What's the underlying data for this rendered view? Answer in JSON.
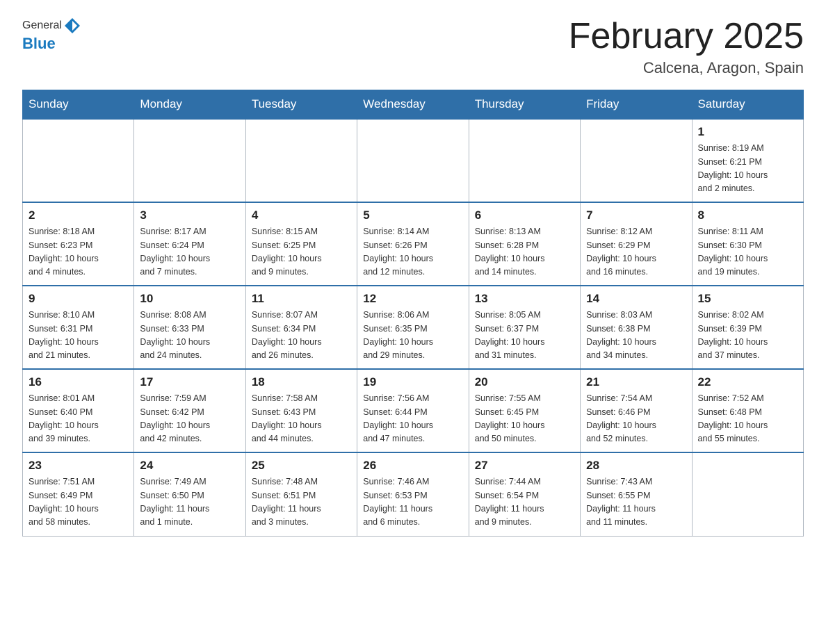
{
  "header": {
    "logo_general": "General",
    "logo_blue": "Blue",
    "month_title": "February 2025",
    "location": "Calcena, Aragon, Spain"
  },
  "weekdays": [
    "Sunday",
    "Monday",
    "Tuesday",
    "Wednesday",
    "Thursday",
    "Friday",
    "Saturday"
  ],
  "weeks": [
    [
      {
        "day": "",
        "info": ""
      },
      {
        "day": "",
        "info": ""
      },
      {
        "day": "",
        "info": ""
      },
      {
        "day": "",
        "info": ""
      },
      {
        "day": "",
        "info": ""
      },
      {
        "day": "",
        "info": ""
      },
      {
        "day": "1",
        "info": "Sunrise: 8:19 AM\nSunset: 6:21 PM\nDaylight: 10 hours\nand 2 minutes."
      }
    ],
    [
      {
        "day": "2",
        "info": "Sunrise: 8:18 AM\nSunset: 6:23 PM\nDaylight: 10 hours\nand 4 minutes."
      },
      {
        "day": "3",
        "info": "Sunrise: 8:17 AM\nSunset: 6:24 PM\nDaylight: 10 hours\nand 7 minutes."
      },
      {
        "day": "4",
        "info": "Sunrise: 8:15 AM\nSunset: 6:25 PM\nDaylight: 10 hours\nand 9 minutes."
      },
      {
        "day": "5",
        "info": "Sunrise: 8:14 AM\nSunset: 6:26 PM\nDaylight: 10 hours\nand 12 minutes."
      },
      {
        "day": "6",
        "info": "Sunrise: 8:13 AM\nSunset: 6:28 PM\nDaylight: 10 hours\nand 14 minutes."
      },
      {
        "day": "7",
        "info": "Sunrise: 8:12 AM\nSunset: 6:29 PM\nDaylight: 10 hours\nand 16 minutes."
      },
      {
        "day": "8",
        "info": "Sunrise: 8:11 AM\nSunset: 6:30 PM\nDaylight: 10 hours\nand 19 minutes."
      }
    ],
    [
      {
        "day": "9",
        "info": "Sunrise: 8:10 AM\nSunset: 6:31 PM\nDaylight: 10 hours\nand 21 minutes."
      },
      {
        "day": "10",
        "info": "Sunrise: 8:08 AM\nSunset: 6:33 PM\nDaylight: 10 hours\nand 24 minutes."
      },
      {
        "day": "11",
        "info": "Sunrise: 8:07 AM\nSunset: 6:34 PM\nDaylight: 10 hours\nand 26 minutes."
      },
      {
        "day": "12",
        "info": "Sunrise: 8:06 AM\nSunset: 6:35 PM\nDaylight: 10 hours\nand 29 minutes."
      },
      {
        "day": "13",
        "info": "Sunrise: 8:05 AM\nSunset: 6:37 PM\nDaylight: 10 hours\nand 31 minutes."
      },
      {
        "day": "14",
        "info": "Sunrise: 8:03 AM\nSunset: 6:38 PM\nDaylight: 10 hours\nand 34 minutes."
      },
      {
        "day": "15",
        "info": "Sunrise: 8:02 AM\nSunset: 6:39 PM\nDaylight: 10 hours\nand 37 minutes."
      }
    ],
    [
      {
        "day": "16",
        "info": "Sunrise: 8:01 AM\nSunset: 6:40 PM\nDaylight: 10 hours\nand 39 minutes."
      },
      {
        "day": "17",
        "info": "Sunrise: 7:59 AM\nSunset: 6:42 PM\nDaylight: 10 hours\nand 42 minutes."
      },
      {
        "day": "18",
        "info": "Sunrise: 7:58 AM\nSunset: 6:43 PM\nDaylight: 10 hours\nand 44 minutes."
      },
      {
        "day": "19",
        "info": "Sunrise: 7:56 AM\nSunset: 6:44 PM\nDaylight: 10 hours\nand 47 minutes."
      },
      {
        "day": "20",
        "info": "Sunrise: 7:55 AM\nSunset: 6:45 PM\nDaylight: 10 hours\nand 50 minutes."
      },
      {
        "day": "21",
        "info": "Sunrise: 7:54 AM\nSunset: 6:46 PM\nDaylight: 10 hours\nand 52 minutes."
      },
      {
        "day": "22",
        "info": "Sunrise: 7:52 AM\nSunset: 6:48 PM\nDaylight: 10 hours\nand 55 minutes."
      }
    ],
    [
      {
        "day": "23",
        "info": "Sunrise: 7:51 AM\nSunset: 6:49 PM\nDaylight: 10 hours\nand 58 minutes."
      },
      {
        "day": "24",
        "info": "Sunrise: 7:49 AM\nSunset: 6:50 PM\nDaylight: 11 hours\nand 1 minute."
      },
      {
        "day": "25",
        "info": "Sunrise: 7:48 AM\nSunset: 6:51 PM\nDaylight: 11 hours\nand 3 minutes."
      },
      {
        "day": "26",
        "info": "Sunrise: 7:46 AM\nSunset: 6:53 PM\nDaylight: 11 hours\nand 6 minutes."
      },
      {
        "day": "27",
        "info": "Sunrise: 7:44 AM\nSunset: 6:54 PM\nDaylight: 11 hours\nand 9 minutes."
      },
      {
        "day": "28",
        "info": "Sunrise: 7:43 AM\nSunset: 6:55 PM\nDaylight: 11 hours\nand 11 minutes."
      },
      {
        "day": "",
        "info": ""
      }
    ]
  ]
}
